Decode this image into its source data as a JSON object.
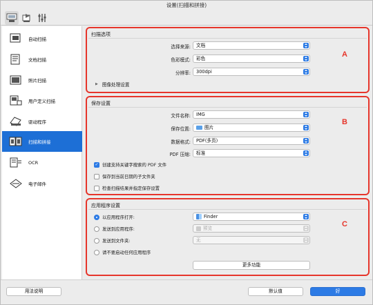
{
  "window": {
    "title": "设置(扫描和拼接)"
  },
  "toolbar": {
    "icons": [
      "scan-from-computer-icon",
      "scan-from-panel-icon",
      "general-settings-icon"
    ]
  },
  "sidebar": {
    "items": [
      {
        "label": "自动扫描",
        "icon": "auto-scan-icon"
      },
      {
        "label": "文档扫描",
        "icon": "document-scan-icon"
      },
      {
        "label": "照片扫描",
        "icon": "photo-scan-icon"
      },
      {
        "label": "用户定义扫描",
        "icon": "custom-scan-icon"
      },
      {
        "label": "驱动程序",
        "icon": "driver-icon"
      },
      {
        "label": "扫描和拼接",
        "icon": "stitch-icon",
        "selected": true
      },
      {
        "label": "OCR",
        "icon": "ocr-icon"
      },
      {
        "label": "电子邮件",
        "icon": "email-icon"
      }
    ]
  },
  "scan_options": {
    "title": "扫描选项",
    "letter": "A",
    "source_label": "选择来源:",
    "source_value": "文档",
    "color_label": "色彩模式:",
    "color_value": "彩色",
    "resolution_label": "分辨率:",
    "resolution_value": "300dpi",
    "image_processing_label": "图像处理设置"
  },
  "save_settings": {
    "title": "保存设置",
    "letter": "B",
    "filename_label": "文件名称:",
    "filename_value": "IMG",
    "location_label": "保存位置:",
    "location_value": "图片",
    "format_label": "数据格式:",
    "format_value": "PDF(多页)",
    "compression_label": "PDF 压缩:",
    "compression_value": "标准",
    "check_keyword_pdf": "创建支持关键字搜索的 PDF 文件",
    "check_keyword_pdf_checked": true,
    "check_date_subfolder": "保存到当前日期的子文件夹",
    "check_date_subfolder_checked": false,
    "check_confirm": "检查扫描结果并指定保存设置",
    "check_confirm_checked": false
  },
  "app_settings": {
    "title": "应用程序设置",
    "letter": "C",
    "radio_open_app": "以应用程序打开:",
    "open_app_value": "Finder",
    "radio_send_app": "发送到应用程序:",
    "send_app_value": "预览",
    "radio_send_folder": "发送到文件夹:",
    "send_folder_value": "无",
    "radio_none": "请不要启动任何应用程序",
    "selected_radio": "open_app",
    "more_functions": "更多功能"
  },
  "footer": {
    "instructions": "用法说明",
    "defaults": "默认值",
    "ok": "好"
  },
  "colors": {
    "accent": "#2d7be5",
    "highlight": "#e6352b",
    "sidebar_selected": "#1d6fd6"
  }
}
